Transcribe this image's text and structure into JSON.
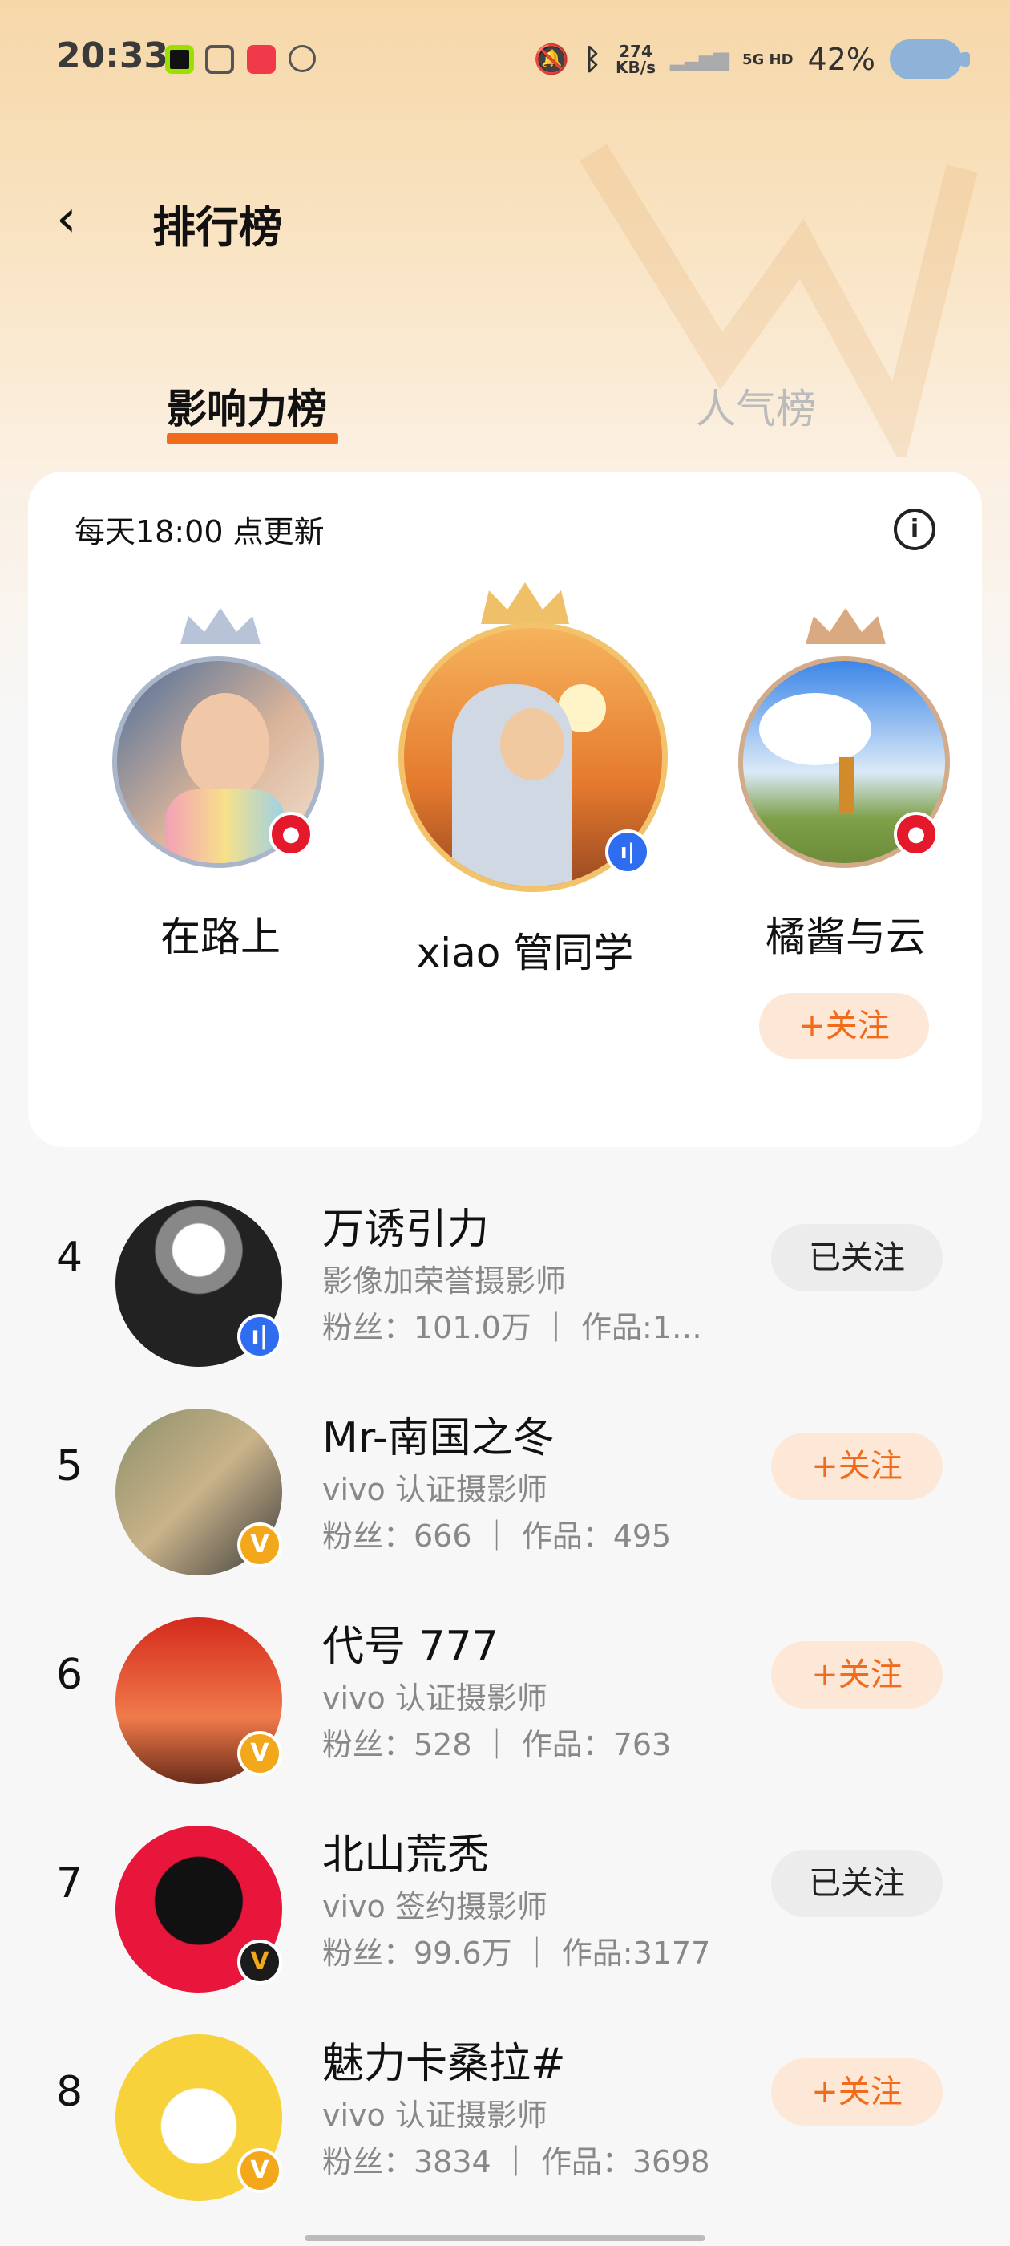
{
  "status_bar": {
    "time": "20:33",
    "net_speed_top": "274",
    "net_speed_bottom": "KB/s",
    "network": "5G HD",
    "battery": "42%"
  },
  "header": {
    "title": "排行榜"
  },
  "tabs": [
    {
      "label": "影响力榜",
      "active": true
    },
    {
      "label": "人气榜",
      "active": false
    }
  ],
  "card": {
    "update_text": "每天18:00 点更新",
    "podium": [
      {
        "rank": 2,
        "name": "在路上",
        "badge": "camera-badge"
      },
      {
        "rank": 1,
        "name": "xiao 管同学",
        "badge": "blue-badge"
      },
      {
        "rank": 3,
        "name": "橘酱与云",
        "badge": "camera-badge",
        "follow_label": "+关注"
      }
    ]
  },
  "rows": [
    {
      "rank": "4",
      "name": "万诱引力",
      "title": "影像加荣誉摄影师",
      "stats": "粉丝：101.0万 ｜ 作品:1…",
      "button": "已关注",
      "followed": true,
      "badge": "blue"
    },
    {
      "rank": "5",
      "name": "Mr-南国之冬",
      "title": "vivo 认证摄影师",
      "stats": "粉丝：666 ｜ 作品：495",
      "button": "+关注",
      "followed": false,
      "badge": "V"
    },
    {
      "rank": "6",
      "name": "代号 777",
      "title": "vivo 认证摄影师",
      "stats": "粉丝：528 ｜ 作品：763",
      "button": "+关注",
      "followed": false,
      "badge": "V"
    },
    {
      "rank": "7",
      "name": "北山荒秃",
      "title": "vivo 签约摄影师",
      "stats": "粉丝：99.6万 ｜ 作品:3177",
      "button": "已关注",
      "followed": true,
      "badge": "V-dark"
    },
    {
      "rank": "8",
      "name": "魅力卡桑拉#",
      "title": "vivo 认证摄影师",
      "stats": "粉丝：3834 ｜ 作品：3698",
      "button": "+关注",
      "followed": false,
      "badge": "V"
    }
  ],
  "colors": {
    "accent": "#f06c1c",
    "follow_bg": "#fde8d7",
    "followed_bg": "#ececec"
  }
}
